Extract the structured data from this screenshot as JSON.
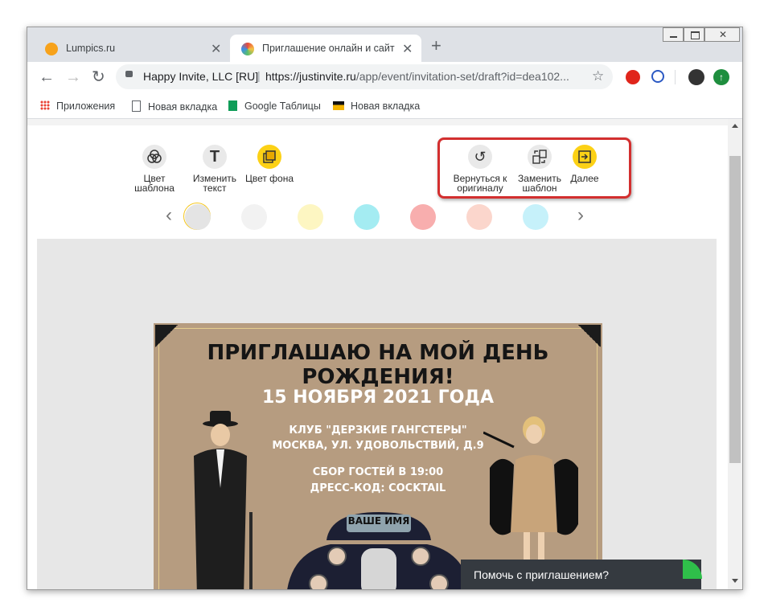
{
  "browser": {
    "tabs": [
      {
        "title": "Lumpics.ru",
        "active": false
      },
      {
        "title": "Приглашение онлайн и сайт ме",
        "active": true
      }
    ],
    "new_tab_symbol": "+",
    "omnibox": {
      "site_name": "Happy Invite, LLC [RU]",
      "separator": "|",
      "url_main": "https://justinvite.ru",
      "url_path": "/app/event/invitation-set/draft?id=dea102..."
    },
    "bookmarks": [
      {
        "label": "Приложения",
        "icon": "apps-grid-icon"
      },
      {
        "label": "Новая вкладка",
        "icon": "page-icon"
      },
      {
        "label": "Google Таблицы",
        "icon": "sheets-icon"
      },
      {
        "label": "Новая вкладка",
        "icon": "image-icon"
      }
    ]
  },
  "editor": {
    "tools": [
      {
        "line1": "Цвет",
        "line2": "шаблона",
        "icon": "palette-icon"
      },
      {
        "line1": "Изменить",
        "line2": "текст",
        "icon": "text-icon"
      },
      {
        "line1": "Цвет фона",
        "line2": "",
        "icon": "background-icon"
      }
    ],
    "actions": [
      {
        "line1": "Вернуться к",
        "line2": "оригиналу",
        "icon": "undo-icon"
      },
      {
        "line1": "Заменить",
        "line2": "шаблон",
        "icon": "replace-icon"
      },
      {
        "line1": "Далее",
        "line2": "",
        "icon": "next-icon"
      }
    ],
    "swatches": [
      "#e4e4e4",
      "#f2f2f2",
      "#fdf6c2",
      "#a4ecf2",
      "#f8aeae",
      "#fbd6cc",
      "#c6f1fa"
    ],
    "highlight_color": "#d32f2f",
    "accent_color": "#fcd116"
  },
  "invitation": {
    "heading": "ПРИГЛАШАЮ НА МОЙ ДЕНЬ РОЖДЕНИЯ!",
    "date": "15 НОЯБРЯ 2021 ГОДА",
    "club": "КЛУБ \"ДЕРЗКИЕ ГАНГСТЕРЫ\"",
    "address": "МОСКВА, УЛ. УДОВОЛЬСТВИЙ, Д.9",
    "gathering": "СБОР ГОСТЕЙ В 19:00",
    "dress_code": "ДРЕСС-КОД: COCKTAIL",
    "plate": "ВАШЕ ИМЯ"
  },
  "help_chat": {
    "label": "Помочь с приглашением?"
  }
}
